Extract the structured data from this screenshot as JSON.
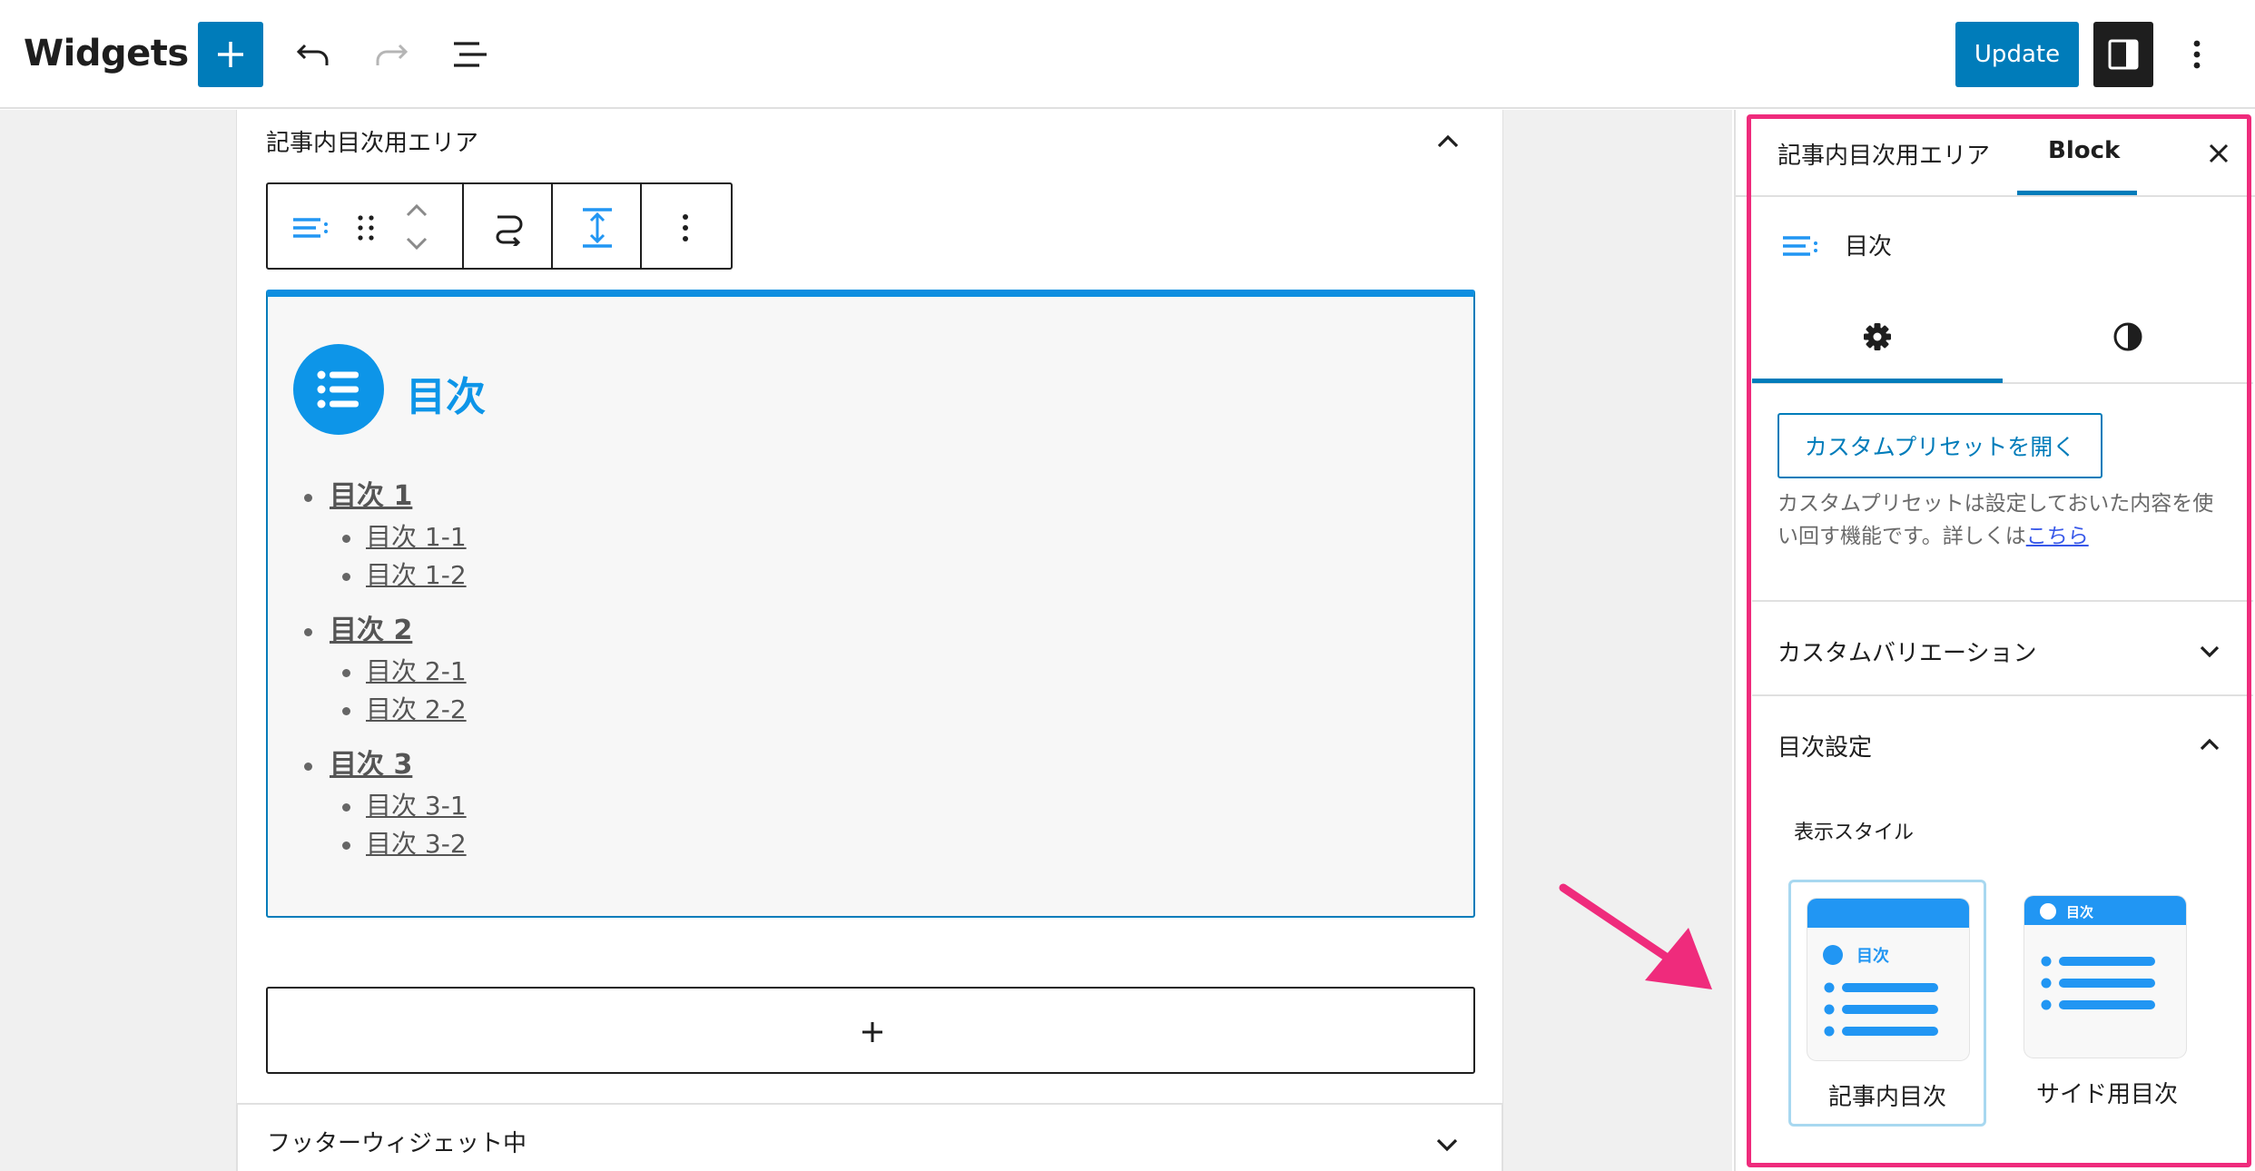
{
  "topbar": {
    "title": "Widgets",
    "update_label": "Update"
  },
  "canvas": {
    "widget_area_title": "記事内目次用エリア",
    "toc": {
      "title": "目次",
      "items": [
        {
          "label": "目次 1",
          "children": [
            "目次 1-1",
            "目次 1-2"
          ]
        },
        {
          "label": "目次 2",
          "children": [
            "目次 2-1",
            "目次 2-2"
          ]
        },
        {
          "label": "目次 3",
          "children": [
            "目次 3-1",
            "目次 3-2"
          ]
        }
      ]
    },
    "footer_area_title": "フッターウィジェット中"
  },
  "sidebar": {
    "tab_area": "記事内目次用エリア",
    "tab_block": "Block",
    "block_name": "目次",
    "preset_button": "カスタムプリセットを開く",
    "preset_help": "カスタムプリセットは設定しておいた内容を使い回す機能です。詳しくは",
    "preset_link": "こちら",
    "variation_panel": "カスタムバリエーション",
    "toc_settings_panel": "目次設定",
    "display_style_label": "表示スタイル",
    "styles": [
      {
        "caption": "記事内目次",
        "thumb_label": "目次",
        "selected": true
      },
      {
        "caption": "サイド用目次",
        "thumb_label": "目次",
        "selected": false
      }
    ]
  },
  "colors": {
    "wp_blue": "#007cba",
    "toc_blue": "#0d95e8",
    "highlight_pink": "#ef2b7c"
  }
}
